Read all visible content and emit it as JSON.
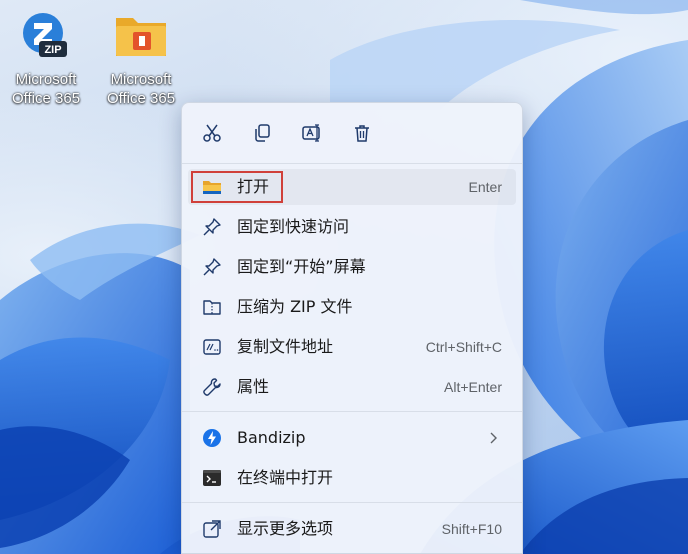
{
  "desktop": {
    "icons": [
      {
        "label": "Microsoft\nOffice 365",
        "icon": "zip-icon"
      },
      {
        "label": "Microsoft\nOffice 365",
        "icon": "office-folder-icon"
      }
    ]
  },
  "context_menu": {
    "toolbar": [
      {
        "action": "cut",
        "icon": "scissors-icon"
      },
      {
        "action": "copy",
        "icon": "copy-icon"
      },
      {
        "action": "rename",
        "icon": "rename-icon"
      },
      {
        "action": "delete",
        "icon": "trash-icon"
      }
    ],
    "items": [
      {
        "label": "打开",
        "shortcut": "Enter",
        "icon": "folder-icon",
        "highlighted": true
      },
      {
        "label": "固定到快速访问",
        "shortcut": "",
        "icon": "pin-icon"
      },
      {
        "label": "固定到“开始”屏幕",
        "shortcut": "",
        "icon": "pin-icon"
      },
      {
        "label": "压缩为 ZIP 文件",
        "shortcut": "",
        "icon": "zip-folder-icon"
      },
      {
        "label": "复制文件地址",
        "shortcut": "Ctrl+Shift+C",
        "icon": "copy-path-icon"
      },
      {
        "label": "属性",
        "shortcut": "Alt+Enter",
        "icon": "wrench-icon"
      },
      {
        "label": "Bandizip",
        "shortcut": "",
        "icon": "bandizip-icon",
        "submenu": true
      },
      {
        "label": "在终端中打开",
        "shortcut": "",
        "icon": "terminal-icon"
      },
      {
        "label": "显示更多选项",
        "shortcut": "Shift+F10",
        "icon": "external-link-icon"
      }
    ]
  },
  "colors": {
    "highlight_border": "#d0403a",
    "accent_blue": "#1565c0",
    "folder_yellow": "#f5bb3b"
  }
}
